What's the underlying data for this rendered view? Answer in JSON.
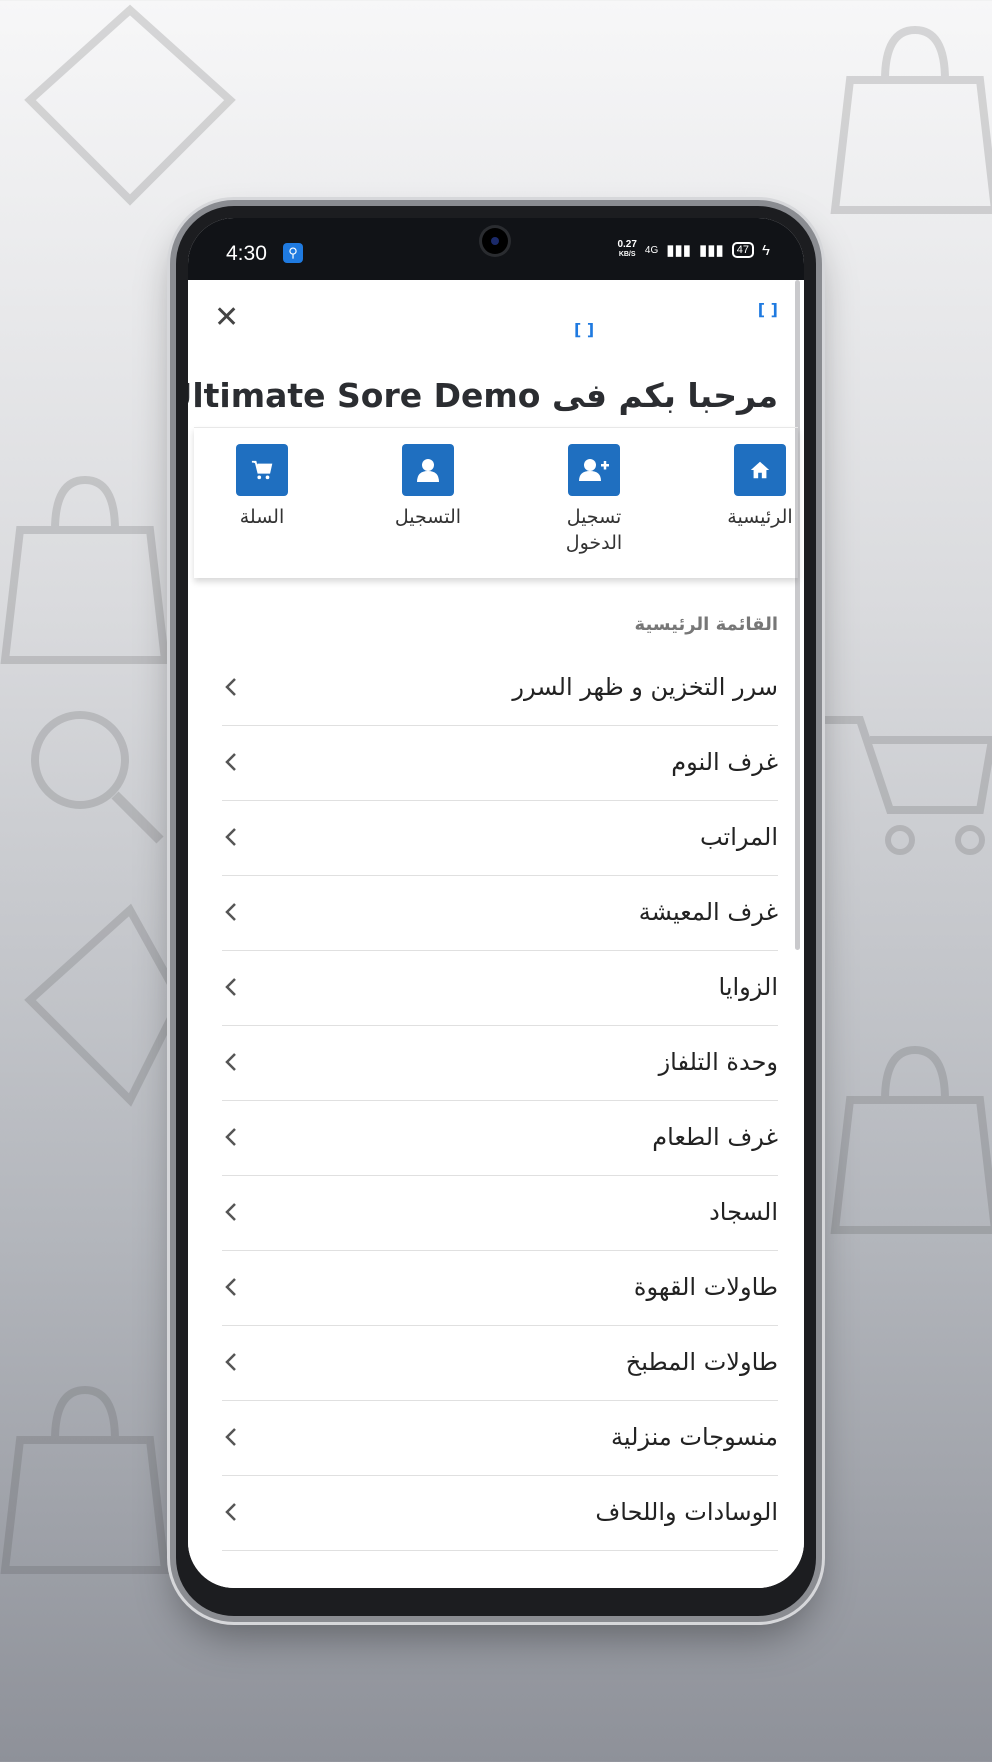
{
  "statusbar": {
    "time": "4:30",
    "speed_value": "0.27",
    "speed_unit": "KB/S",
    "network": "4G",
    "battery": "47"
  },
  "header": {
    "bracket_a": "[ ]",
    "bracket_b": "[ ]",
    "welcome": "مرحبا بكم فى Ultimate Sore Demo"
  },
  "quick_actions": [
    {
      "label": "الرئيسية",
      "icon": "home-icon"
    },
    {
      "label": "تسجيل الدخول",
      "icon": "user-plus-icon"
    },
    {
      "label": "التسجيل",
      "icon": "user-icon"
    },
    {
      "label": "السلة",
      "icon": "cart-icon"
    }
  ],
  "menu": {
    "title": "القائمة الرئيسية",
    "items": [
      "سرر التخزين و ظهر السرر",
      "غرف النوم",
      "المراتب",
      "غرف المعيشة",
      "الزوايا",
      "وحدة التلفاز",
      "غرف الطعام",
      "السجاد",
      "طاولات القهوة",
      "طاولات المطبخ",
      "منسوجات منزلية",
      "الوسادات واللحاف"
    ]
  },
  "colors": {
    "accent": "#1f6fc0",
    "bracket": "#1f7ae0"
  }
}
